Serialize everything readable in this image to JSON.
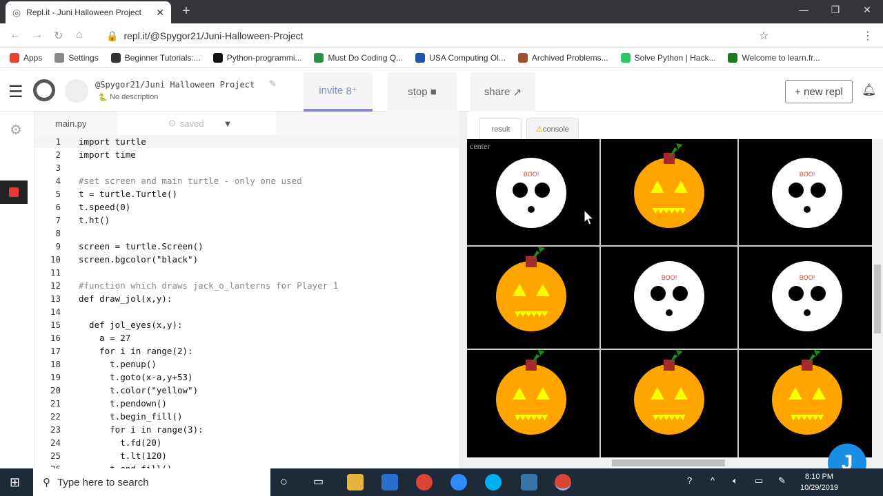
{
  "browser": {
    "tab_title": "Repl.it - Juni Halloween Project",
    "url": "repl.it/@Spygor21/Juni-Halloween-Project",
    "bookmarks": [
      {
        "label": "Apps",
        "color": "#e94235"
      },
      {
        "label": "Settings",
        "color": "#888"
      },
      {
        "label": "Beginner Tutorials:...",
        "color": "#333"
      },
      {
        "label": "Python-programmi...",
        "color": "#111"
      },
      {
        "label": "Must Do Coding Q...",
        "color": "#2f8d46"
      },
      {
        "label": "USA Computing Ol...",
        "color": "#2255aa"
      },
      {
        "label": "Archived Problems...",
        "color": "#a0522d"
      },
      {
        "label": "Solve Python | Hack...",
        "color": "#2ec866"
      },
      {
        "label": "Welcome to learn.fr...",
        "color": "#1b7a1b"
      }
    ]
  },
  "repl": {
    "owner_path": "@Spygor21/Juni Halloween Project",
    "description": "No description",
    "invite": "invite",
    "stop": "stop",
    "share": "share",
    "new_repl": "+ new repl",
    "accent": "#8389c9"
  },
  "editor": {
    "file": "main.py",
    "status": "saved",
    "lines": [
      "import turtle",
      "import time",
      "",
      "#set screen and main turtle - only one used",
      "t = turtle.Turtle()",
      "t.speed(0)",
      "t.ht()",
      "",
      "screen = turtle.Screen()",
      "screen.bgcolor(\"black\")",
      "",
      "#function which draws jack_o_lanterns for Player 1",
      "def draw_jol(x,y):",
      "",
      "  def jol_eyes(x,y):",
      "    a = 27",
      "    for i in range(2):",
      "      t.penup()",
      "      t.goto(x-a,y+53)",
      "      t.color(\"yellow\")",
      "      t.pendown()",
      "      t.begin_fill()",
      "      for i in range(3):",
      "        t.fd(20)",
      "        t.lt(120)",
      "      t.end_fill()"
    ]
  },
  "result": {
    "tabs": [
      "result",
      "console"
    ],
    "label": "center",
    "boo": "BOO!",
    "board": [
      [
        "ghost",
        "pumpkin",
        "ghost"
      ],
      [
        "pumpkin",
        "ghost",
        "ghost"
      ],
      [
        "pumpkin",
        "pumpkin",
        "pumpkin"
      ]
    ]
  },
  "taskbar": {
    "search_placeholder": "Type here to search",
    "time": "8:10 PM",
    "date": "10/29/2019"
  }
}
